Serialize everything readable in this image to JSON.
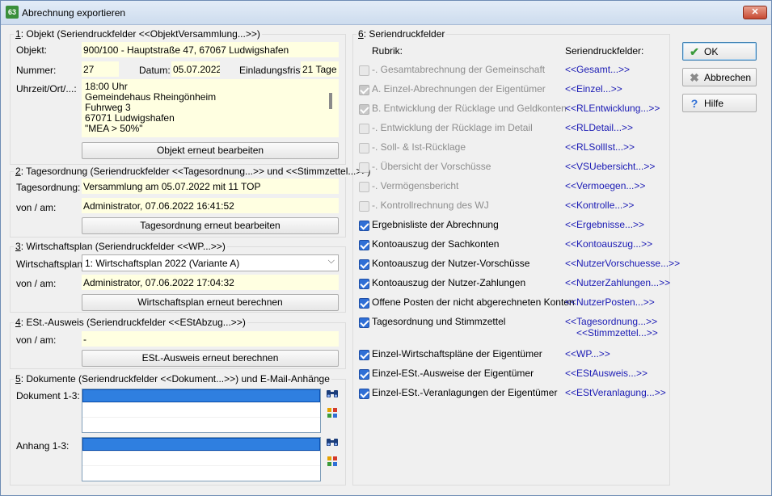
{
  "window": {
    "title": "Abrechnung exportieren",
    "icon": "app-icon",
    "close": "✕"
  },
  "objekt": {
    "legend_num": "1",
    "legend": ": Objekt (Seriendruckfelder <<ObjektVersammlung...>>)",
    "objekt_label": "Objekt:",
    "objekt_value": "900/100 - Hauptstraße 47, 67067 Ludwigshafen",
    "nummer_label": "Nummer:",
    "nummer_value": "27",
    "datum_label": "Datum:",
    "datum_value": "05.07.2022",
    "frist_label": "Einladungsfrist:",
    "frist_value": "21 Tage",
    "uhrzeit_label": "Uhrzeit/Ort/...:",
    "uhrzeit_lines": [
      "18:00 Uhr",
      "Gemeindehaus Rheingönheim",
      "Fuhrweg 3",
      "67071 Ludwigshafen",
      "\"MEA > 50%\""
    ],
    "button": "Objekt erneut bearbeiten"
  },
  "tagesordnung": {
    "legend_num": "2",
    "legend": ": Tagesordnung (Seriendruckfelder <<Tagesordnung...>> und <<Stimmzettel...>>)",
    "to_label": "Tagesordnung:",
    "to_value": "Versammlung am 05.07.2022 mit 11 TOP",
    "von_label": "von / am:",
    "von_value": "Administrator,  07.06.2022 16:41:52",
    "button": "Tagesordnung erneut bearbeiten"
  },
  "wirtschaftsplan": {
    "legend_num": "3",
    "legend": ": Wirtschaftsplan (Seriendruckfelder <<WP...>>)",
    "wp_label": "Wirtschaftsplan:",
    "wp_value": "1: Wirtschaftsplan 2022 (Variante A)",
    "von_label": "von / am:",
    "von_value": "Administrator,  07.06.2022 17:04:32",
    "button": "Wirtschaftsplan erneut berechnen"
  },
  "est": {
    "legend_num": "4",
    "legend": ": ESt.-Ausweis (Seriendruckfelder <<EStAbzug...>>)",
    "von_label": "von / am:",
    "von_value": "-",
    "button": "ESt.-Ausweis erneut berechnen"
  },
  "dokumente": {
    "legend_num": "5",
    "legend": ": Dokumente (Seriendruckfelder <<Dokument...>>) und E-Mail-Anhänge",
    "dok_label": "Dokument 1-3:",
    "anh_label": "Anhang 1-3:"
  },
  "serien": {
    "legend_num": "6",
    "legend": ": Seriendruckfelder",
    "col_rubrik": "Rubrik:",
    "col_felder": "Seriendruckfelder:",
    "rows": [
      {
        "label": "-. Gesamtabrechnung der Gemeinschaft",
        "field": "<<Gesamt...>>",
        "checked": false,
        "disabled": true
      },
      {
        "label": "A. Einzel-Abrechnungen der Eigentümer",
        "field": "<<Einzel...>>",
        "checked": true,
        "disabled": true
      },
      {
        "label": "B. Entwicklung der Rücklage und Geldkonten",
        "field": "<<RLEntwicklung...>>",
        "checked": true,
        "disabled": true
      },
      {
        "label": "-. Entwicklung der Rücklage im Detail",
        "field": "<<RLDetail...>>",
        "checked": false,
        "disabled": true
      },
      {
        "label": "-. Soll- & Ist-Rücklage",
        "field": "<<RLSollIst...>>",
        "checked": false,
        "disabled": true
      },
      {
        "label": "-. Übersicht der Vorschüsse",
        "field": "<<VSUebersicht...>>",
        "checked": false,
        "disabled": true
      },
      {
        "label": "-. Vermögensbericht",
        "field": "<<Vermoegen...>>",
        "checked": false,
        "disabled": true
      },
      {
        "label": "-. Kontrollrechnung des WJ",
        "field": "<<Kontrolle...>>",
        "checked": false,
        "disabled": true
      },
      {
        "label": "Ergebnisliste der Abrechnung",
        "field": "<<Ergebnisse...>>",
        "checked": true,
        "disabled": false
      },
      {
        "label": "Kontoauszug der Sachkonten",
        "field": "<<Kontoauszug...>>",
        "checked": true,
        "disabled": false
      },
      {
        "label": "Kontoauszug der Nutzer-Vorschüsse",
        "field": "<<NutzerVorschuesse...>>",
        "checked": true,
        "disabled": false
      },
      {
        "label": "Kontoauszug der Nutzer-Zahlungen",
        "field": "<<NutzerZahlungen...>>",
        "checked": true,
        "disabled": false
      },
      {
        "label": "Offene Posten der nicht abgerechneten Konten",
        "field": "<<NutzerPosten...>>",
        "checked": true,
        "disabled": false
      },
      {
        "label": "Tagesordnung und Stimmzettel",
        "field": "<<Tagesordnung...>>",
        "field2": "<<Stimmzettel...>>",
        "checked": true,
        "disabled": false
      },
      {
        "label": "Einzel-Wirtschaftspläne der Eigentümer",
        "field": "<<WP...>>",
        "checked": true,
        "disabled": false
      },
      {
        "label": "Einzel-ESt.-Ausweise der Eigentümer",
        "field": "<<EStAusweis...>>",
        "checked": true,
        "disabled": false
      },
      {
        "label": "Einzel-ESt.-Veranlagungen der Eigentümer",
        "field": "<<EStVeranlagung...>>",
        "checked": true,
        "disabled": false
      }
    ]
  },
  "buttons": {
    "ok": "OK",
    "abbrechen": "Abbrechen",
    "hilfe": "Hilfe"
  }
}
